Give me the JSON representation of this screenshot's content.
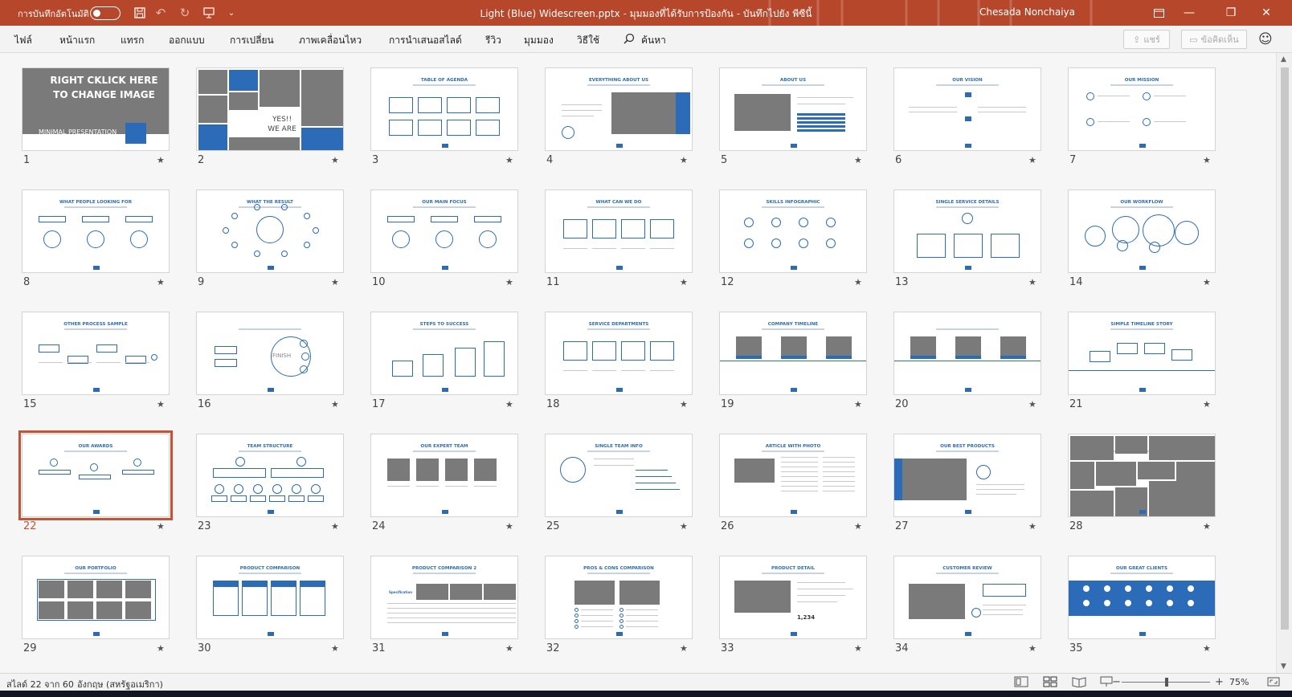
{
  "titlebar": {
    "autosave_label": "การบันทึกอัตโนมัติ",
    "title": "Light (Blue) Widescreen.pptx - มุมมองที่ได้รับการป้องกัน - บันทึกไปยัง พีซีนี้",
    "user": "Chesada Nonchaiya",
    "icons": [
      "save-icon",
      "undo-icon",
      "redo-icon",
      "start-slideshow-icon",
      "customize-quick-access-icon"
    ]
  },
  "ribbon": {
    "tabs": [
      "ไฟล์",
      "หน้าแรก",
      "แทรก",
      "ออกแบบ",
      "การเปลี่ยน",
      "ภาพเคลื่อนไหว",
      "การนำเสนอสไลด์",
      "รีวิว",
      "มุมมอง",
      "วิธีใช้"
    ],
    "search_label": "ค้นหา",
    "share_label": "แชร์",
    "comments_label": "ข้อคิดเห็น"
  },
  "slides": [
    {
      "n": "1",
      "title": "",
      "kind": "cover",
      "cover_lines": [
        "RIGHT CKLICK HERE",
        "TO CHANGE IMAGE"
      ],
      "min_text": "MINIMAL PRESENTATION"
    },
    {
      "n": "2",
      "title": "",
      "kind": "mosaic",
      "yes_lines": [
        "YES!!",
        "WE ARE"
      ]
    },
    {
      "n": "3",
      "title": "TABLE OF AGENDA",
      "kind": "grid4x2"
    },
    {
      "n": "4",
      "title": "EVERYTHING ABOUT US",
      "kind": "about"
    },
    {
      "n": "5",
      "title": "ABOUT US",
      "kind": "image-left-bars"
    },
    {
      "n": "6",
      "title": "OUR VISION",
      "kind": "icons-center"
    },
    {
      "n": "7",
      "title": "OUR MISSION",
      "kind": "icons-2x2"
    },
    {
      "n": "8",
      "title": "WHAT PEOPLE LOOKING FOR",
      "kind": "three-circles"
    },
    {
      "n": "9",
      "title": "WHAT THE RESULT",
      "kind": "hub"
    },
    {
      "n": "10",
      "title": "OUR MAIN FOCUS",
      "kind": "three-circles"
    },
    {
      "n": "11",
      "title": "WHAT CAN WE DO",
      "kind": "four-boxes"
    },
    {
      "n": "12",
      "title": "SKILLS INFOGRAPHIC",
      "kind": "circles-grid"
    },
    {
      "n": "13",
      "title": "SINGLE SERVICE DETAILS",
      "kind": "three-boxes"
    },
    {
      "n": "14",
      "title": "OUR WORKFLOW",
      "kind": "bubbles"
    },
    {
      "n": "15",
      "title": "OTHER PROCESS SAMPLE",
      "kind": "process"
    },
    {
      "n": "16",
      "title": "",
      "kind": "finish",
      "finish_text": "FINISH"
    },
    {
      "n": "17",
      "title": "STEPS TO SUCCESS",
      "kind": "steps"
    },
    {
      "n": "18",
      "title": "SERVICE DEPARTMENTS",
      "kind": "four-boxes"
    },
    {
      "n": "19",
      "title": "COMPANY TIMELINE",
      "kind": "timeline-images"
    },
    {
      "n": "20",
      "title": "",
      "kind": "timeline-images"
    },
    {
      "n": "21",
      "title": "SIMPLE TIMELINE STORY",
      "kind": "timeline-simple"
    },
    {
      "n": "22",
      "title": "OUR AWARDS",
      "kind": "awards",
      "selected": true
    },
    {
      "n": "23",
      "title": "TEAM STRUCTURE",
      "kind": "team"
    },
    {
      "n": "24",
      "title": "OUR EXPERT TEAM",
      "kind": "four-photos"
    },
    {
      "n": "25",
      "title": "SINGLE TEAM INFO",
      "kind": "team-info"
    },
    {
      "n": "26",
      "title": "ARTICLE WITH PHOTO",
      "kind": "article"
    },
    {
      "n": "27",
      "title": "OUR BEST PRODUCTS",
      "kind": "products"
    },
    {
      "n": "28",
      "title": "",
      "kind": "mosaic-full"
    },
    {
      "n": "29",
      "title": "OUR PORTFOLIO",
      "kind": "portfolio"
    },
    {
      "n": "30",
      "title": "PRODUCT COMPARISON",
      "kind": "comparison"
    },
    {
      "n": "31",
      "title": "PRODUCT COMPARISON 2",
      "kind": "comparison2",
      "spec_label": "Specification"
    },
    {
      "n": "32",
      "title": "PROS & CONS COMPARISON",
      "kind": "pros-cons"
    },
    {
      "n": "33",
      "title": "PRODUCT DETAIL",
      "kind": "product-detail",
      "price": "1,234"
    },
    {
      "n": "34",
      "title": "CUSTOMER REVIEW",
      "kind": "review"
    },
    {
      "n": "35",
      "title": "OUR GREAT CLIENTS",
      "kind": "clients"
    }
  ],
  "statusbar": {
    "slide_count": "สไลด์ 22 จาก 60",
    "language": "อังกฤษ (สหรัฐอเมริกา)",
    "zoom": "75%"
  },
  "colors": {
    "titlebar": "#b7472a",
    "accent": "#2b6bb8",
    "selected": "#c65335"
  }
}
